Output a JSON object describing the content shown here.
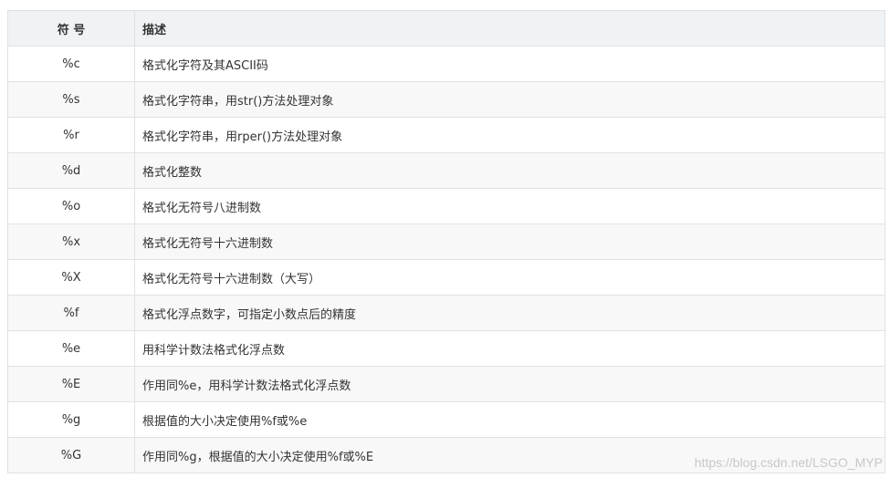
{
  "table": {
    "headers": [
      "符 号",
      "描述"
    ],
    "rows": [
      {
        "symbol": "%c",
        "description": "格式化字符及其ASCII码"
      },
      {
        "symbol": "%s",
        "description": "格式化字符串，用str()方法处理对象"
      },
      {
        "symbol": "%r",
        "description": "格式化字符串，用rper()方法处理对象"
      },
      {
        "symbol": "%d",
        "description": "格式化整数"
      },
      {
        "symbol": "%o",
        "description": "格式化无符号八进制数"
      },
      {
        "symbol": "%x",
        "description": "格式化无符号十六进制数"
      },
      {
        "symbol": "%X",
        "description": "格式化无符号十六进制数（大写）"
      },
      {
        "symbol": "%f",
        "description": "格式化浮点数字，可指定小数点后的精度"
      },
      {
        "symbol": "%e",
        "description": "用科学计数法格式化浮点数"
      },
      {
        "symbol": "%E",
        "description": "作用同%e，用科学计数法格式化浮点数"
      },
      {
        "symbol": "%g",
        "description": "根据值的大小决定使用%f或%e"
      },
      {
        "symbol": "%G",
        "description": "作用同%g，根据值的大小决定使用%f或%E"
      }
    ]
  },
  "watermark": "https://blog.csdn.net/LSGO_MYP",
  "colors": {
    "header_bg": "#eff3f5",
    "row_alt_bg": "#f8f8f8",
    "border": "#dfe2e5",
    "text": "#333333"
  }
}
